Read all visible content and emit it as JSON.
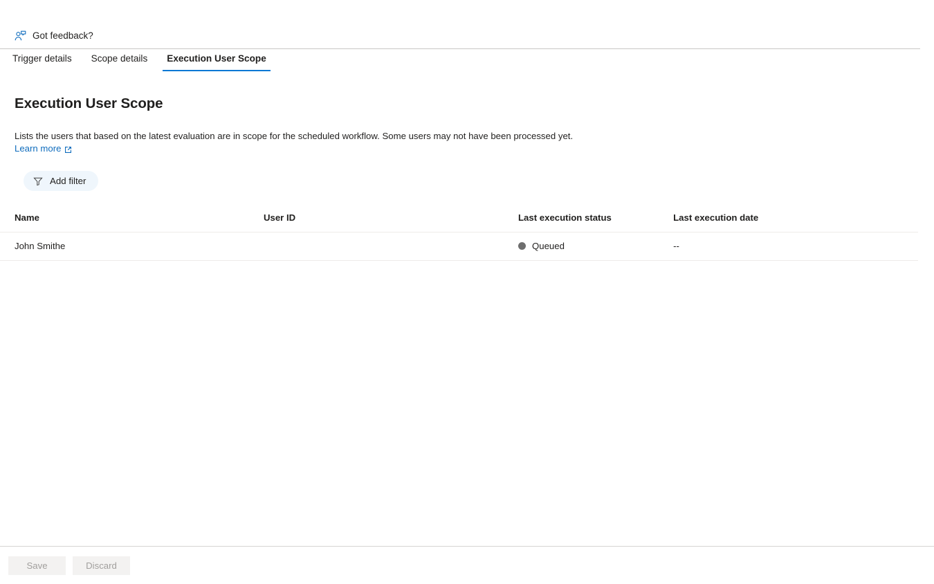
{
  "feedback": {
    "label": "Got feedback?",
    "icon": "person-feedback-icon",
    "icon_color": "#0f6cbd"
  },
  "tabs": [
    {
      "label": "Trigger details",
      "active": false
    },
    {
      "label": "Scope details",
      "active": false
    },
    {
      "label": "Execution User Scope",
      "active": true
    }
  ],
  "accent_color": "#0078d4",
  "main": {
    "title": "Execution User Scope",
    "description": "Lists the users that based on the latest evaluation are in scope for the scheduled workflow. Some users may not have been processed yet.",
    "learn_more_label": "Learn more",
    "learn_more_icon": "external-link-icon",
    "link_color": "#0f6cbd"
  },
  "toolbar": {
    "add_filter_label": "Add filter",
    "add_filter_icon": "funnel-icon",
    "add_filter_bg": "#eff6fc"
  },
  "table": {
    "columns": [
      "Name",
      "User ID",
      "Last execution status",
      "Last execution date"
    ],
    "rows": [
      {
        "name": "John Smithe",
        "user_id": "",
        "status": "Queued",
        "status_color": "#6e6e6e",
        "date": "--"
      }
    ]
  },
  "footer": {
    "save_label": "Save",
    "discard_label": "Discard",
    "disabled_color": "#a19f9d"
  }
}
